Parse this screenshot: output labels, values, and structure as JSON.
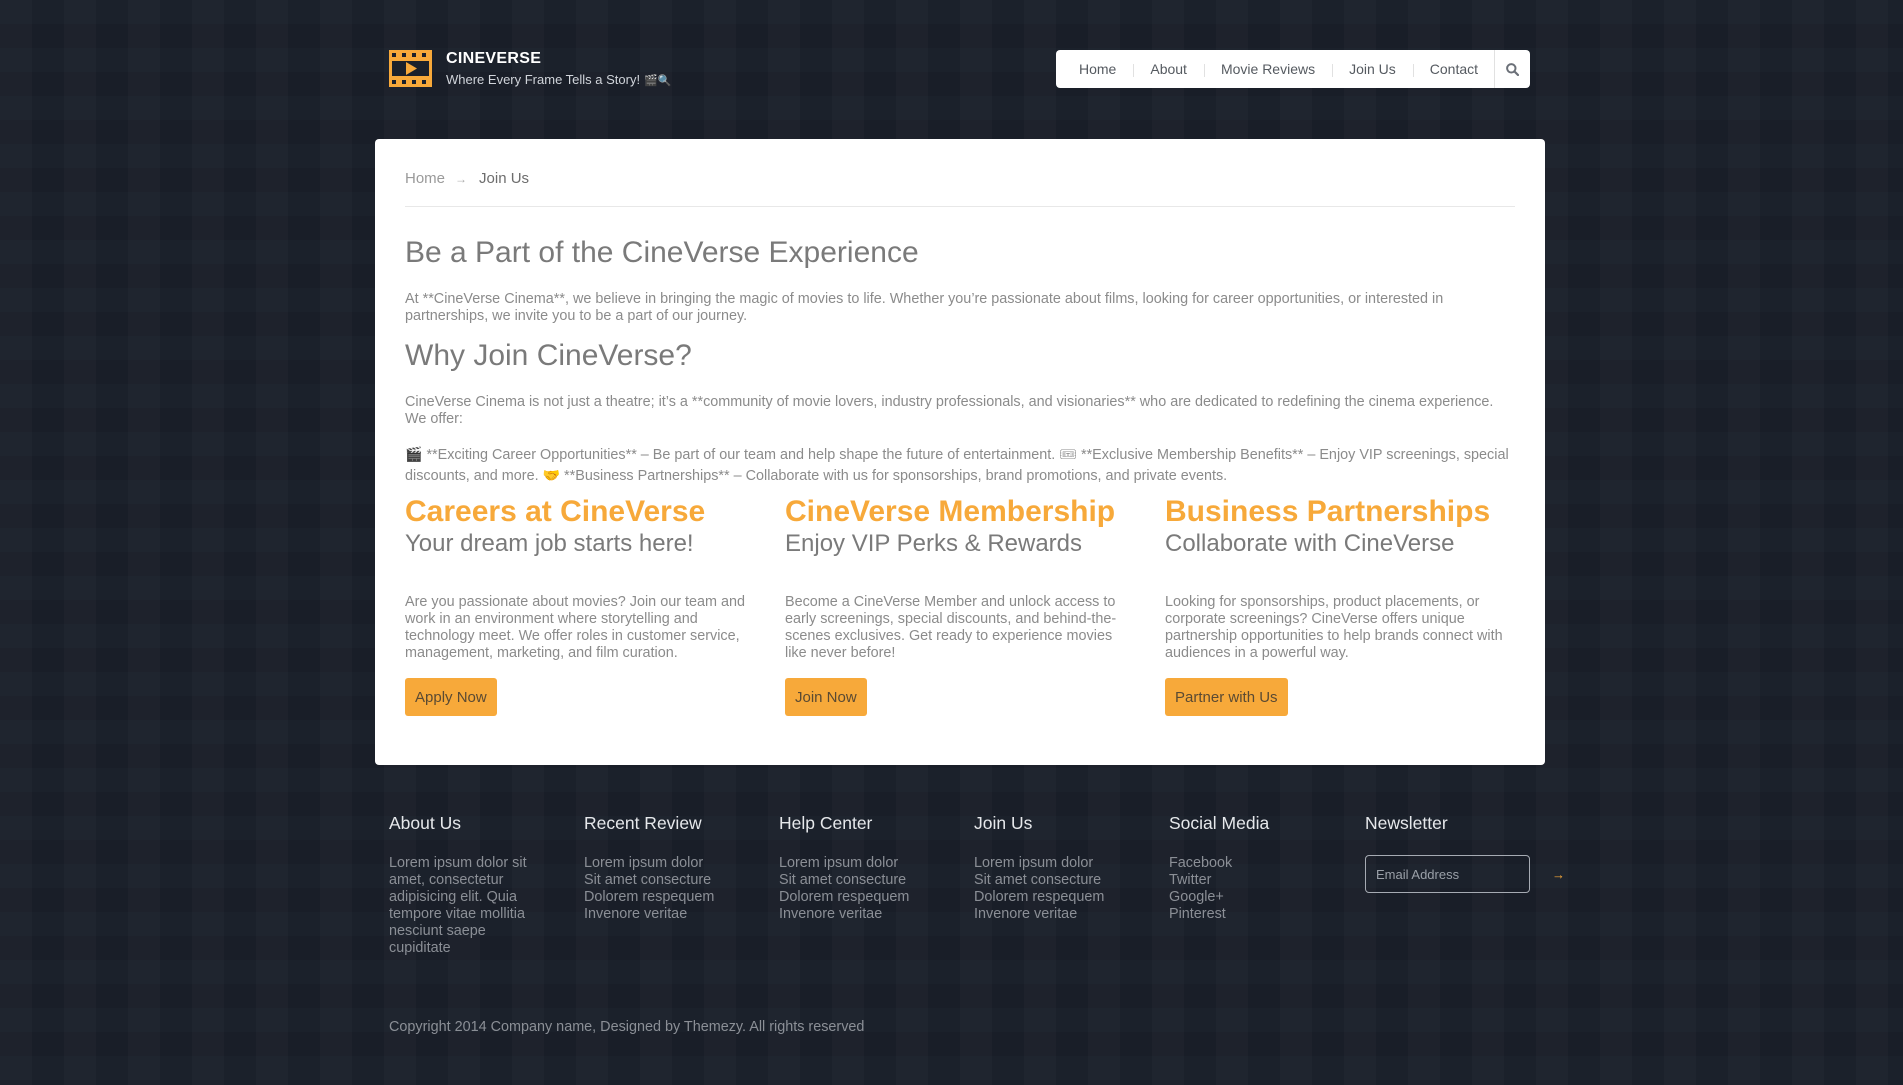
{
  "header": {
    "site_name": "CINEVERSE",
    "tagline": "Where Every Frame Tells a Story!",
    "tagline_emoji": "🎬🔍",
    "brand_color": "#f7a93a"
  },
  "nav": {
    "items": [
      {
        "label": "Home"
      },
      {
        "label": "About"
      },
      {
        "label": "Movie Reviews"
      },
      {
        "label": "Join Us"
      },
      {
        "label": "Contact"
      }
    ],
    "search_icon": "search-icon"
  },
  "breadcrumb": {
    "home": "Home",
    "arrow": "→",
    "current": "Join Us"
  },
  "main": {
    "heading": "Be a Part of the CineVerse Experience",
    "intro": "At **CineVerse Cinema**, we believe in bringing the magic of movies to life. Whether you’re passionate about films, looking for career opportunities, or interested in partnerships, we invite you to be a part of our journey.",
    "why_heading": "Why Join CineVerse?",
    "why_text": "CineVerse Cinema is not just a theatre; it’s a **community of movie lovers, industry professionals, and visionaries** who are dedicated to redefining the cinema experience. We offer:",
    "offers": {
      "icon1": "🎬",
      "text1": "**Exciting Career Opportunities** – Be part of our team and help shape the future of entertainment.",
      "icon2": "🎟",
      "text2": "**Exclusive Membership Benefits** – Enjoy VIP screenings, special discounts, and more.",
      "icon3": "🤝",
      "text3": "**Business Partnerships** – Collaborate with us for sponsorships, brand promotions, and private events."
    },
    "columns": [
      {
        "title": "Careers at CineVerse",
        "subtitle": "Your dream job starts here!",
        "text": "Are you passionate about movies? Join our team and work in an environment where storytelling and technology meet. We offer roles in customer service, management, marketing, and film curation.",
        "button": "Apply Now"
      },
      {
        "title": "CineVerse Membership",
        "subtitle": "Enjoy VIP Perks & Rewards",
        "text": "Become a CineVerse Member and unlock access to early screenings, special discounts, and behind-the-scenes exclusives. Get ready to experience movies like never before!",
        "button": "Join Now"
      },
      {
        "title": "Business Partnerships",
        "subtitle": "Collaborate with CineVerse",
        "text": "Looking for sponsorships, product placements, or corporate screenings? CineVerse offers unique partnership opportunities to help brands connect with audiences in a powerful way.",
        "button": "Partner with Us"
      }
    ]
  },
  "footer": {
    "about": {
      "title": "About Us",
      "text": "Lorem ipsum dolor sit amet, consectetur adipisicing elit. Quia tempore vitae mollitia nesciunt saepe cupiditate"
    },
    "recent": {
      "title": "Recent Review",
      "items": [
        "Lorem ipsum dolor",
        "Sit amet consecture",
        "Dolorem respequem",
        "Invenore veritae"
      ]
    },
    "help": {
      "title": "Help Center",
      "items": [
        "Lorem ipsum dolor",
        "Sit amet consecture",
        "Dolorem respequem",
        "Invenore veritae"
      ]
    },
    "join": {
      "title": "Join Us",
      "items": [
        "Lorem ipsum dolor",
        "Sit amet consecture",
        "Dolorem respequem",
        "Invenore veritae"
      ]
    },
    "social": {
      "title": "Social Media",
      "items": [
        "Facebook",
        "Twitter",
        "Google+",
        "Pinterest"
      ]
    },
    "newsletter": {
      "title": "Newsletter",
      "placeholder": "Email Address",
      "submit_icon": "arrow-right-icon"
    },
    "copyright": "Copyright 2014 Company name, Designed by Themezy. All rights reserved"
  }
}
